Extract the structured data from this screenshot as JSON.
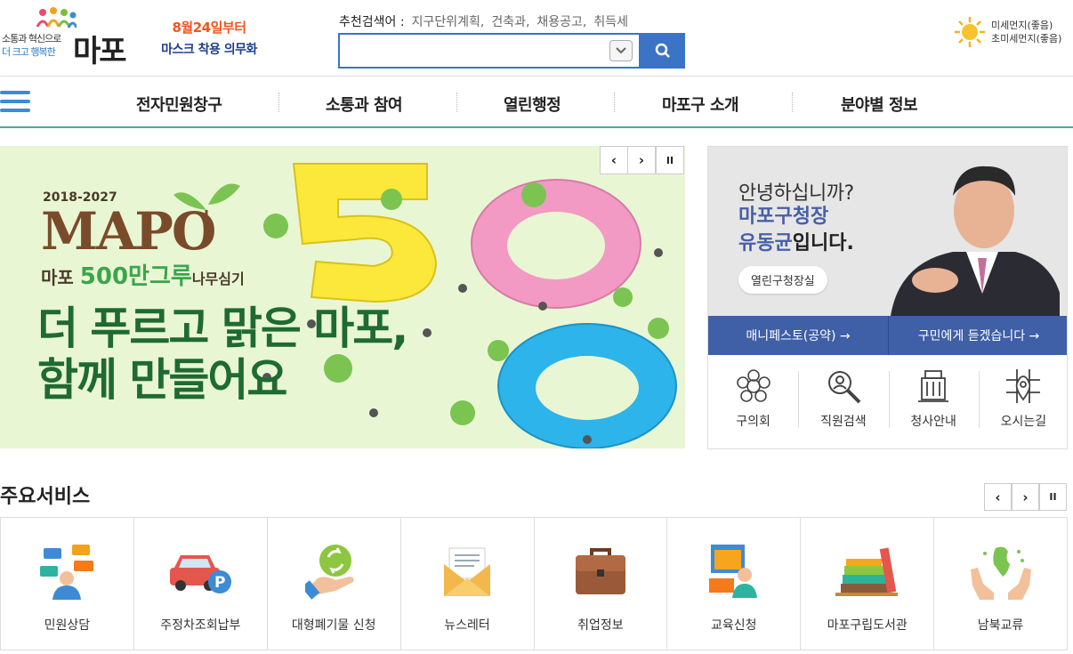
{
  "header": {
    "logo_slogan_line1": "소통과 혁신으로",
    "logo_slogan_line2": "더 크고 행복한",
    "logo_name": "마포",
    "notice_line1": "8월24일부터",
    "notice_line2": "마스크 착용 의무화",
    "recommended_label": "추천검색어 :",
    "recommended_terms": [
      "지구단위계획,",
      "건축과,",
      "채용공고,",
      "취득세"
    ],
    "search_value": "",
    "weather_line1": "미세먼지(좋음)",
    "weather_line2": "초미세먼지(좋음)"
  },
  "gnb": {
    "items": [
      "전자민원창구",
      "소통과 참여",
      "열린행정",
      "마포구 소개",
      "분야별 정보"
    ]
  },
  "banner": {
    "years": "2018-2027",
    "mapo": "MAPO",
    "tag_prefix": "마포 ",
    "tag_green": "500만그루",
    "tag_suffix": "나무심기",
    "headline_line1": "더 푸르고 맑은 마포,",
    "headline_line2": "함께 만들어요",
    "prev": "‹",
    "next": "›",
    "pause": "II"
  },
  "mayor": {
    "greeting": "안녕하십니까?",
    "title": "마포구청장",
    "name": "유동균",
    "name_suffix": "입니다.",
    "office_button": "열린구청장실",
    "manifesto_link": "매니페스토(공약) →",
    "listen_link": "구민에게 듣겠습니다 →",
    "quick_links": [
      "구의회",
      "직원검색",
      "청사안내",
      "오시는길"
    ]
  },
  "services": {
    "title": "주요서비스",
    "prev": "‹",
    "next": "›",
    "pause": "II",
    "items": [
      "민원상담",
      "주정차조회납부",
      "대형폐기물 신청",
      "뉴스레터",
      "취업정보",
      "교육신청",
      "마포구립도서관",
      "남북교류"
    ]
  },
  "colors": {
    "brand_blue": "#3b74c4",
    "nav_line": "#4ea79a",
    "mayor_bar": "#3f5fa6",
    "notice_orange": "#f0561e",
    "banner_bg": "#e9f6d4"
  }
}
